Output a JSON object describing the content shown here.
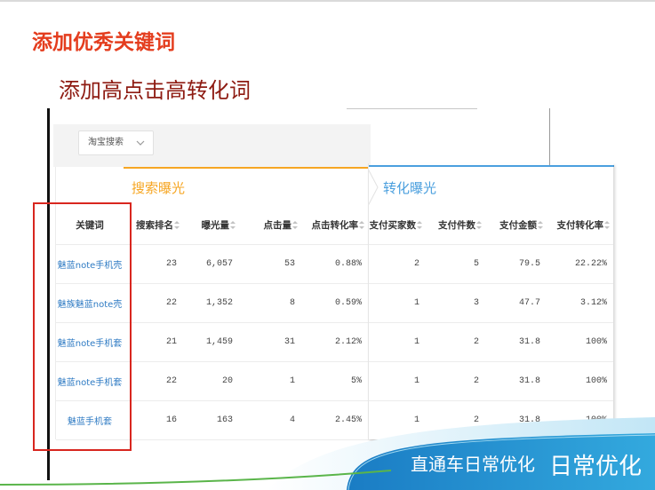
{
  "slide": {
    "title": "添加优秀关键词",
    "subtitle": "添加高点击高转化词",
    "footer_label": "直通车日常优化",
    "footer_label_large": "日常优化"
  },
  "filter": {
    "dropdown_value": "淘宝搜索"
  },
  "sections": {
    "search": "搜索曝光",
    "conversion": "转化曝光"
  },
  "table": {
    "headers": {
      "keyword": "关键词",
      "search_rank": "搜索排名",
      "impressions": "曝光量",
      "clicks": "点击量",
      "click_conversion_rate": "点击转化率",
      "paying_buyers": "支付买家数",
      "paid_items": "支付件数",
      "paid_amount": "支付金额",
      "payment_conversion_rate": "支付转化率"
    },
    "rows": [
      {
        "keyword": "魅蓝note手机壳",
        "search_rank": "23",
        "impressions": "6,057",
        "clicks": "53",
        "click_conversion_rate": "0.88%",
        "paying_buyers": "2",
        "paid_items": "5",
        "paid_amount": "79.5",
        "payment_conversion_rate": "22.22%"
      },
      {
        "keyword": "魅族魅蓝note壳",
        "search_rank": "22",
        "impressions": "1,352",
        "clicks": "8",
        "click_conversion_rate": "0.59%",
        "paying_buyers": "1",
        "paid_items": "3",
        "paid_amount": "47.7",
        "payment_conversion_rate": "3.12%"
      },
      {
        "keyword": "魅蓝note手机套",
        "search_rank": "21",
        "impressions": "1,459",
        "clicks": "31",
        "click_conversion_rate": "2.12%",
        "paying_buyers": "1",
        "paid_items": "2",
        "paid_amount": "31.8",
        "payment_conversion_rate": "100%"
      },
      {
        "keyword": "魅蓝note手机套",
        "search_rank": "22",
        "impressions": "20",
        "clicks": "1",
        "click_conversion_rate": "5%",
        "paying_buyers": "1",
        "paid_items": "2",
        "paid_amount": "31.8",
        "payment_conversion_rate": "100%"
      },
      {
        "keyword": "魅蓝手机套",
        "search_rank": "16",
        "impressions": "163",
        "clicks": "4",
        "click_conversion_rate": "2.45%",
        "paying_buyers": "1",
        "paid_items": "2",
        "paid_amount": "31.8",
        "payment_conversion_rate": "100%"
      }
    ]
  },
  "icons": {
    "dropdown": "chevron-down-icon",
    "sort": "sort-icon",
    "step_separator": "step-arrow-icon"
  },
  "colors": {
    "title": "#e43d1e",
    "subtitle": "#8e1b12",
    "search_accent": "#f6a623",
    "conversion_accent": "#4a9fde",
    "keyword_link": "#2d7ac3",
    "highlight_box": "#d8261f"
  }
}
